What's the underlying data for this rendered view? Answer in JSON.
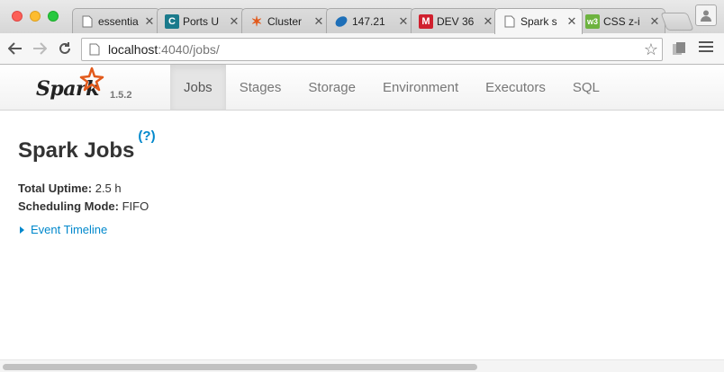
{
  "browser": {
    "tabs": [
      {
        "title": "essentia",
        "icon": "document-icon",
        "active": false
      },
      {
        "title": "Ports U",
        "icon": "c-logo-icon",
        "active": false
      },
      {
        "title": "Cluster",
        "icon": "spark-star-icon",
        "active": false
      },
      {
        "title": "147.21",
        "icon": "leaf-icon",
        "active": false
      },
      {
        "title": "DEV 36",
        "icon": "m-logo-icon",
        "active": false
      },
      {
        "title": "Spark s",
        "icon": "document-icon",
        "active": true
      },
      {
        "title": "CSS z-i",
        "icon": "w3-logo-icon",
        "active": false
      }
    ],
    "url_host": "localhost",
    "url_rest": ":4040/jobs/",
    "colors": {
      "close": "#fc5f57",
      "minimize": "#fdbc2e",
      "zoom": "#28c840"
    }
  },
  "spark": {
    "brand": "Spark",
    "version": "1.5.2",
    "nav": [
      "Jobs",
      "Stages",
      "Storage",
      "Environment",
      "Executors",
      "SQL"
    ],
    "active_nav": "Jobs",
    "page_title": "Spark Jobs",
    "help_mark": "?",
    "summary": [
      {
        "key": "Total Uptime:",
        "value": "2.5 h"
      },
      {
        "key": "Scheduling Mode:",
        "value": "FIFO"
      }
    ],
    "event_timeline": "Event Timeline",
    "accent": "#0088cc"
  },
  "scrollbar": {
    "horizontal_visible_fraction": 0.66
  }
}
